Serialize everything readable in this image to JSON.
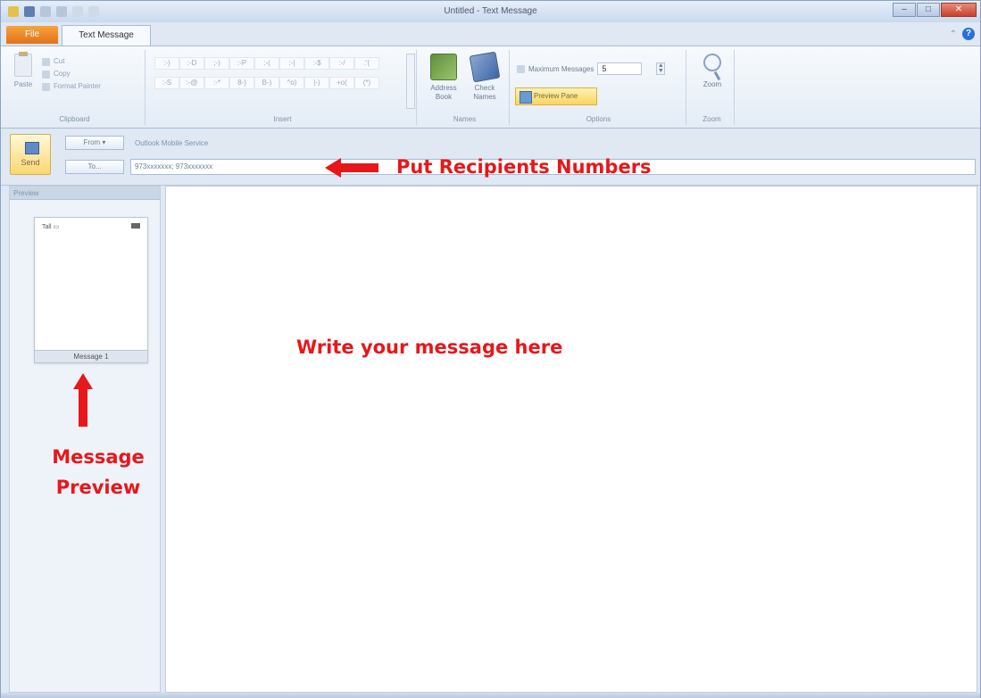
{
  "window": {
    "title": "Untitled - Text Message",
    "controls": {
      "minimize": "–",
      "maximize": "□",
      "close": "✕"
    }
  },
  "tabs": {
    "file": "File",
    "active": "Text Message"
  },
  "ribbon": {
    "clipboard": {
      "label": "Clipboard",
      "paste": "Paste",
      "cut": "Cut",
      "copy": "Copy",
      "format_painter": "Format Painter"
    },
    "insert": {
      "label": "Insert",
      "symbols": [
        ":-)",
        ":-D",
        ";-)",
        ":-P",
        ":-(",
        ":-|",
        ":-$",
        ":-/",
        ":'(",
        ":-S",
        ":-@",
        ":-*",
        "8-)",
        "B-)",
        "^o)",
        "|-)",
        "+o(",
        "(*)"
      ]
    },
    "names": {
      "label": "Names",
      "address_book": "Address Book",
      "check_names": "Check Names"
    },
    "options": {
      "label": "Options",
      "max_messages_label": "Maximum Messages",
      "max_messages_value": "5",
      "preview_pane": "Preview Pane"
    },
    "zoom": {
      "label": "Zoom",
      "button": "Zoom"
    }
  },
  "header": {
    "send": "Send",
    "from": "From ▾",
    "to": "To...",
    "service": "Outlook Mobile Service",
    "recipients": "973xxxxxxx; 973xxxxxxx"
  },
  "preview": {
    "header": "Preview",
    "signal": "Tall ▭",
    "message_caption": "Message 1"
  },
  "annotations": {
    "recipients": "Put Recipients Numbers",
    "write": "Write your message here",
    "preview_line1": "Message",
    "preview_line2": "Preview"
  },
  "colors": {
    "annotation": "#e8171a",
    "file_tab": "#e2711a",
    "send_highlight": "#fbd772"
  }
}
